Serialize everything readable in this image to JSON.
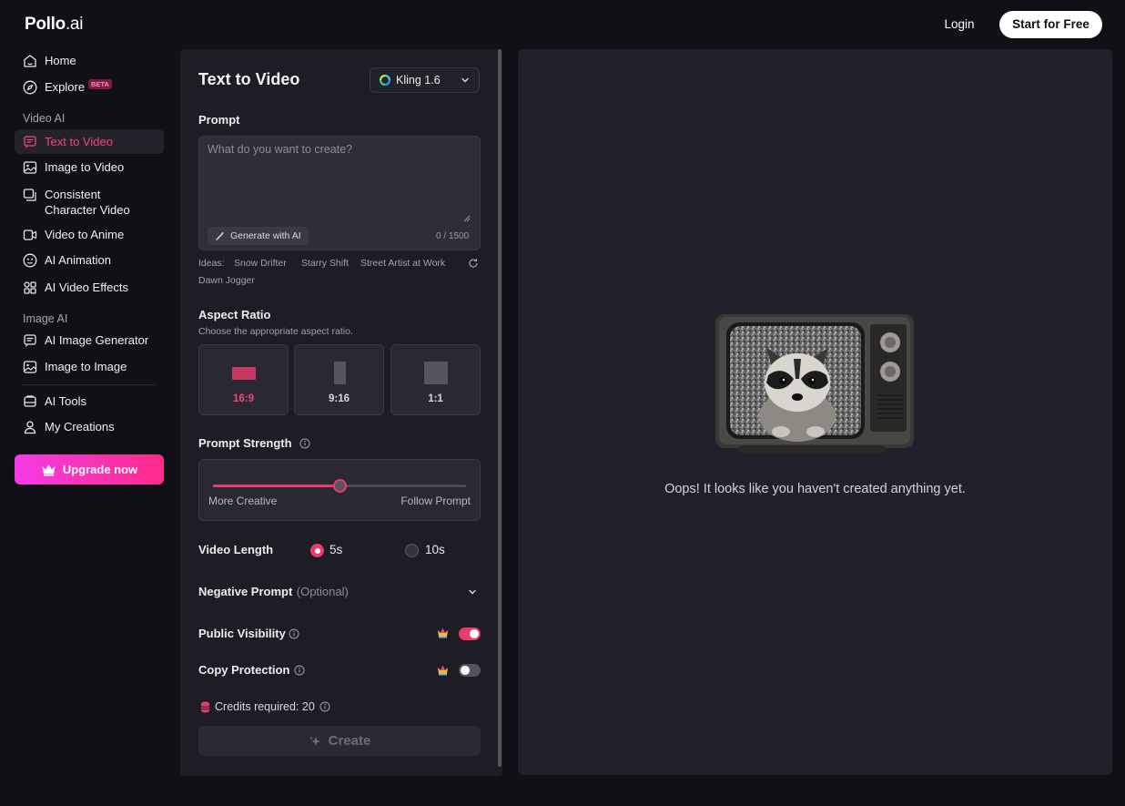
{
  "header": {
    "logo_main": "Pollo",
    "logo_suffix": ".ai",
    "login_label": "Login",
    "start_label": "Start for Free"
  },
  "sidebar": {
    "home": "Home",
    "explore": "Explore",
    "explore_badge": "BETA",
    "video_ai_title": "Video AI",
    "text_to_video": "Text to Video",
    "image_to_video": "Image to Video",
    "consistent_line1": "Consistent",
    "consistent_line2": "Character Video",
    "video_to_anime": "Video to Anime",
    "ai_animation": "AI Animation",
    "ai_video_effects": "AI Video Effects",
    "image_ai_title": "Image AI",
    "ai_image_generator": "AI Image Generator",
    "image_to_image": "Image to Image",
    "ai_tools": "AI Tools",
    "my_creations": "My Creations",
    "upgrade": "Upgrade now"
  },
  "panel": {
    "title": "Text to Video",
    "model": "Kling 1.6",
    "prompt_label": "Prompt",
    "prompt_placeholder": "What do you want to create?",
    "prompt_value": "",
    "generate_ai": "Generate with AI",
    "counter": "0 / 1500",
    "ideas_label": "Ideas:",
    "ideas": [
      "Snow Drifter",
      "Starry Shift",
      "Street Artist at Work",
      "Dawn Jogger"
    ],
    "aspect_label": "Aspect Ratio",
    "aspect_sub": "Choose the appropriate aspect ratio.",
    "aspect_options": [
      "16:9",
      "9:16",
      "1:1"
    ],
    "aspect_selected": "16:9",
    "strength_label": "Prompt Strength",
    "strength_value": 0.5,
    "strength_left": "More Creative",
    "strength_right": "Follow Prompt",
    "video_length_label": "Video Length",
    "length_options": [
      "5s",
      "10s"
    ],
    "length_selected": "5s",
    "negative_label": "Negative Prompt",
    "negative_optional": "(Optional)",
    "public_label": "Public Visibility",
    "public_on": true,
    "copy_label": "Copy Protection",
    "copy_on": false,
    "credits_label": "Credits required: 20",
    "create_label": "Create"
  },
  "preview": {
    "empty_message": "Oops! It looks like you haven't created anything yet."
  },
  "colors": {
    "accent": "#e83d6b",
    "background": "#111016",
    "panel": "#1e1d26",
    "preview": "#22212b",
    "upgrade_gradient_start": "#f33ce6",
    "upgrade_gradient_end": "#ff2a8a"
  }
}
